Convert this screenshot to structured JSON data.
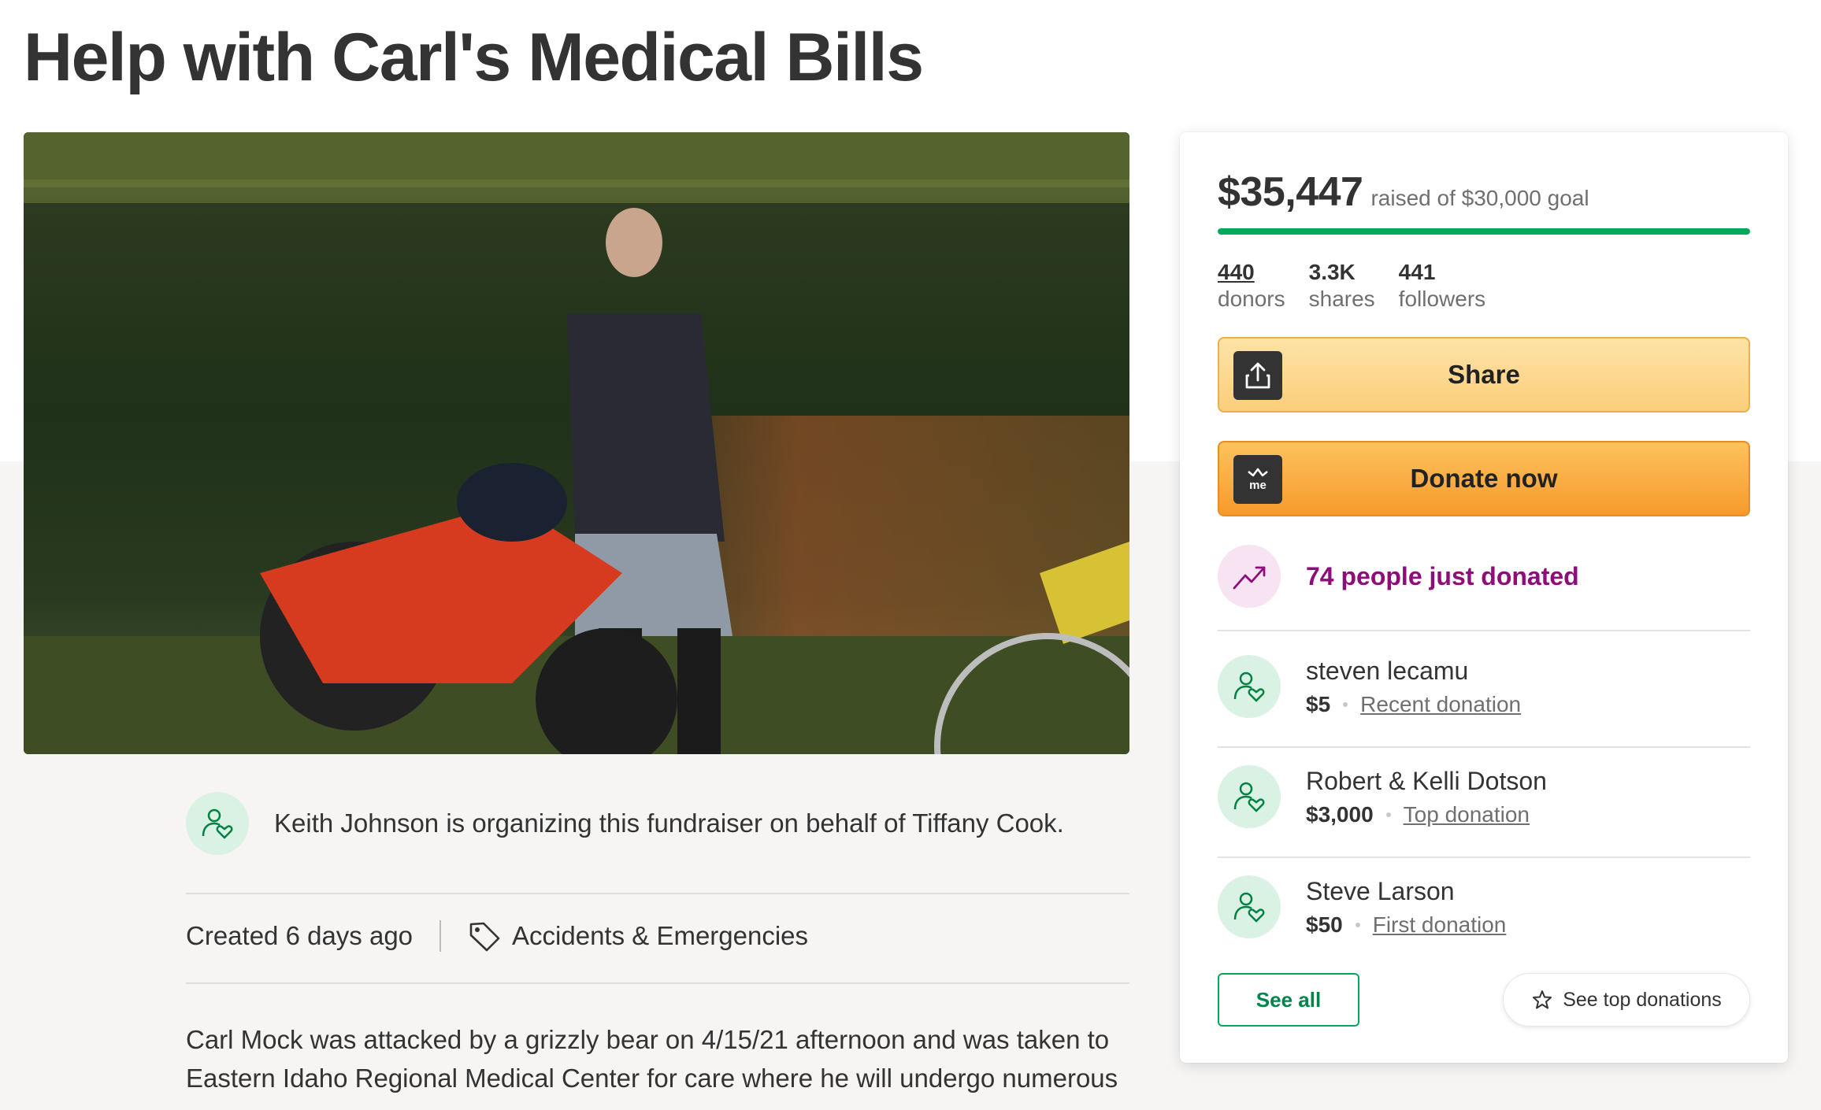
{
  "campaign": {
    "title": "Help with Carl's Medical Bills",
    "organizer_text": "Keith Johnson is organizing this fundraiser on behalf of Tiffany Cook.",
    "created": "Created 6 days ago",
    "category": "Accidents & Emergencies",
    "story_line1": "Carl Mock was attacked by a grizzly bear on 4/15/21  afternoon and was taken to",
    "story_line2": "Eastern Idaho Regional Medical Center for care where he will undergo numerous"
  },
  "progress": {
    "raised": "$35,447",
    "goal_text": "raised of $30,000 goal",
    "fraction": 1.0,
    "bar_color": "#02a95c"
  },
  "stats": [
    {
      "value": "440",
      "label": "donors"
    },
    {
      "value": "3.3K",
      "label": "shares"
    },
    {
      "value": "441",
      "label": "followers"
    }
  ],
  "buttons": {
    "share": "Share",
    "share_icon": "share-upload-icon",
    "donate": "Donate now",
    "donate_icon": "gofundme-logo-icon",
    "see_all": "See all",
    "see_top": "See top donations"
  },
  "trending": {
    "text": "74 people just donated",
    "icon": "trending-up-icon",
    "color": "#8f0d7a"
  },
  "donations": [
    {
      "name": "steven lecamu",
      "amount": "$5",
      "tag": "Recent donation"
    },
    {
      "name": "Robert & Kelli Dotson",
      "amount": "$3,000",
      "tag": "Top donation"
    },
    {
      "name": "Steve Larson",
      "amount": "$50",
      "tag": "First donation"
    }
  ],
  "colors": {
    "accent_green": "#02a95c",
    "donate_orange": "#f79a2b",
    "share_yellow": "#fbce7a"
  }
}
